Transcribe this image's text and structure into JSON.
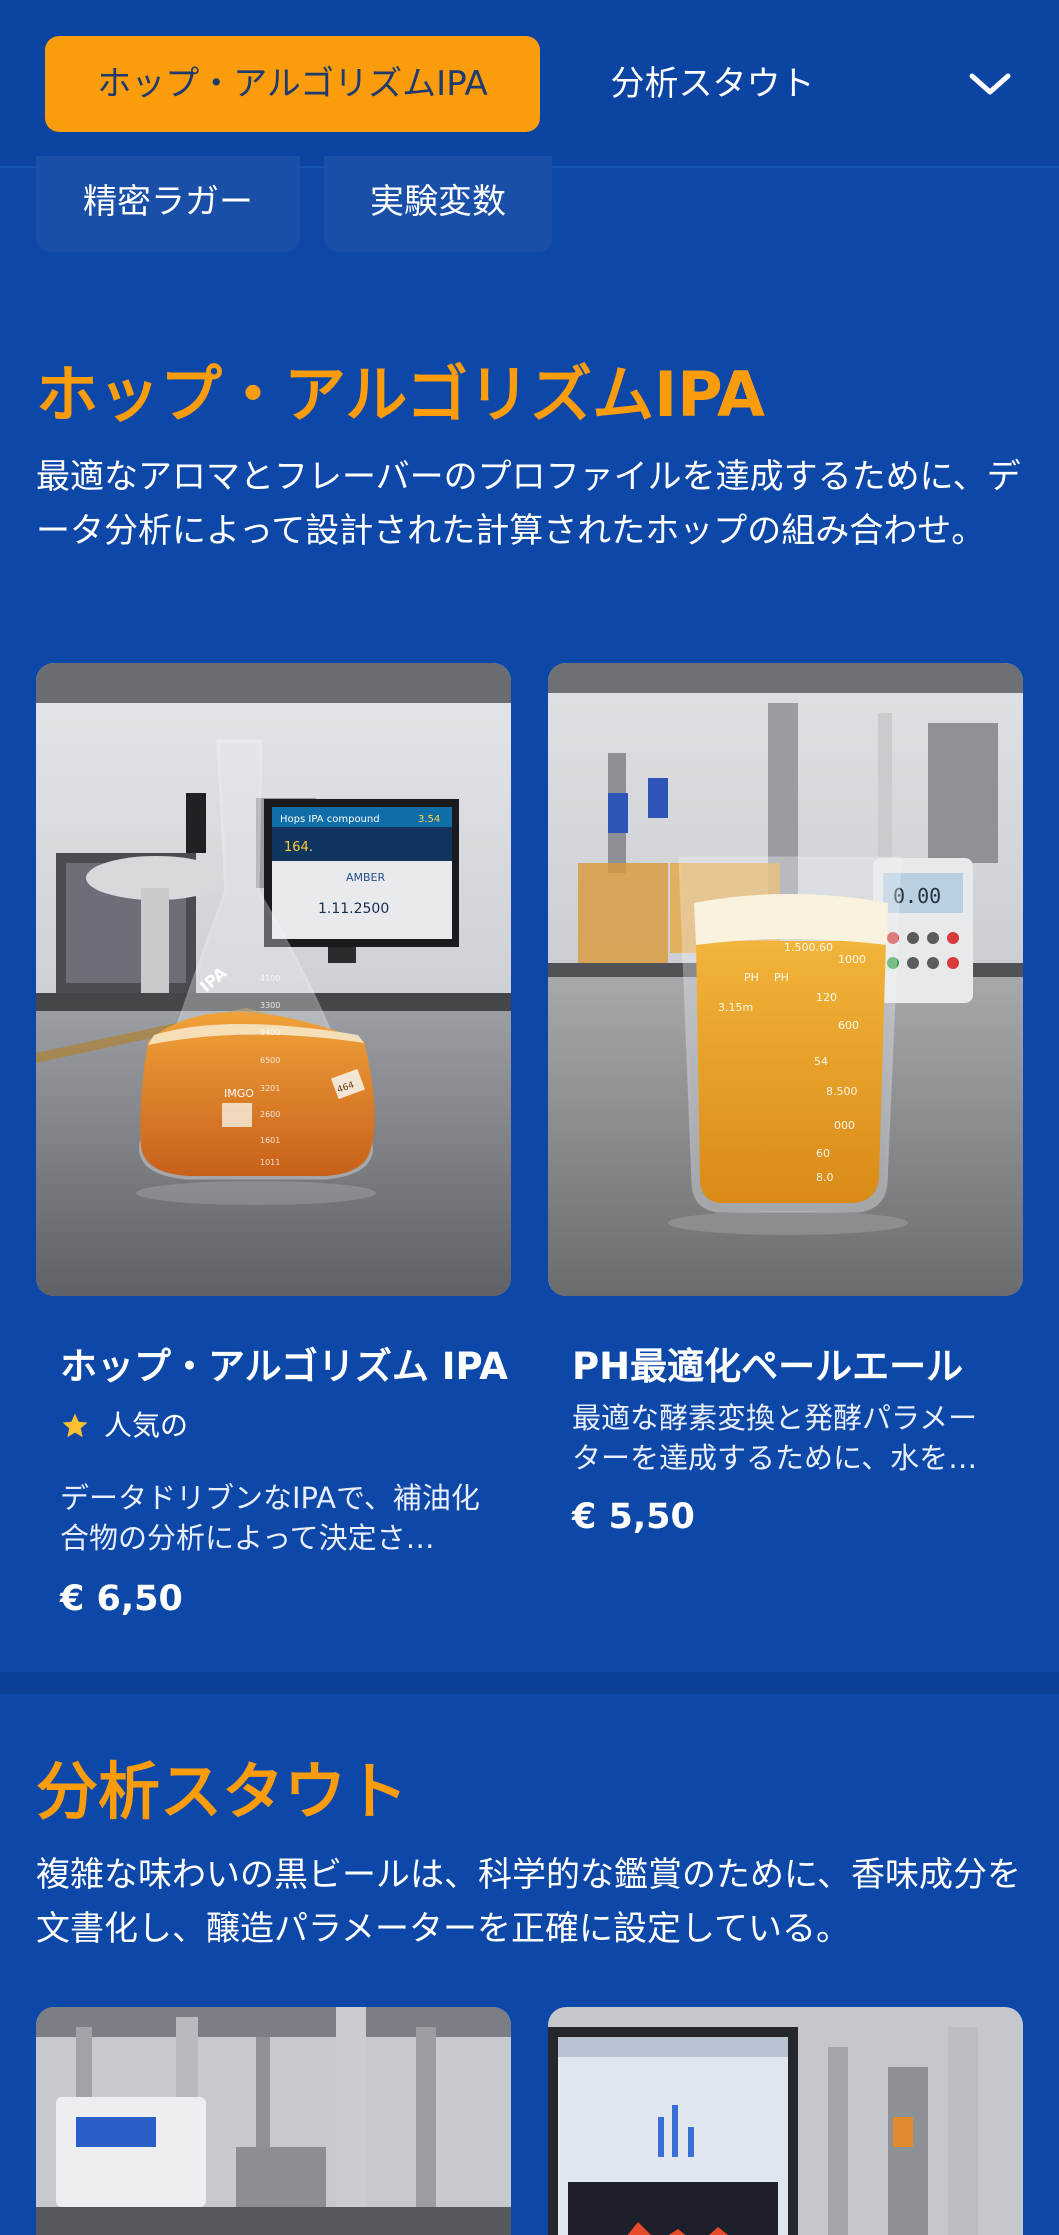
{
  "tabs": {
    "active_label": "ホップ・アルゴリズムIPA",
    "second_label": "分析スタウト"
  },
  "chips": [
    "精密ラガー",
    "実験変数"
  ],
  "sections": [
    {
      "title": "ホップ・アルゴリズムIPA",
      "description": "最適なアロマとフレーバーのプロファイルを達成するために、データ分析によって設計された計算されたホップの組み合わせ。",
      "products": [
        {
          "name": "ホップ・アルゴリズム IPA",
          "badge": "人気の",
          "description": "データドリブンなIPAで、補油化合物の分析によって決定さ…",
          "price": "€ 6,50",
          "image_text": {
            "monitor_title": "Hops IPA compound",
            "monitor_value": "3.54",
            "monitor_reading": "164.",
            "monitor_label": "AMBER",
            "monitor_number": "1.11.2500",
            "flask_label": "IPA",
            "flask_marks": [
              "4100",
              "3300",
              "9400",
              "6500",
              "3201",
              "2600",
              "1601",
              "1011"
            ],
            "flask_tag": "IMGO",
            "flask_tag2": "464"
          }
        },
        {
          "name": "PH最適化ペールエール",
          "badge": "",
          "description": "最適な酵素変換と発酵パラメーターを達成するために、水を…",
          "price": "€ 5,50",
          "image_text": {
            "meter_value": "0.00",
            "beaker_marks": [
              "1.500.60",
              "1000",
              "PH",
              "PH",
              "120",
              "3.15m",
              "600",
              "54",
              "8.500",
              "000",
              "60",
              "8.0"
            ]
          }
        }
      ]
    },
    {
      "title": "分析スタウト",
      "description": "複雑な味わいの黒ビールは、科学的な鑑賞のために、香味成分を文書化し、醸造パラメーターを正確に設定している。"
    }
  ],
  "colors": {
    "background": "#0d47a8",
    "accent": "#fb9c0c",
    "chip": "#1a4fa8",
    "star": "#fbc02d"
  },
  "icons": {
    "tabs_toggle": "chevron-down-icon",
    "popular": "star-icon"
  }
}
